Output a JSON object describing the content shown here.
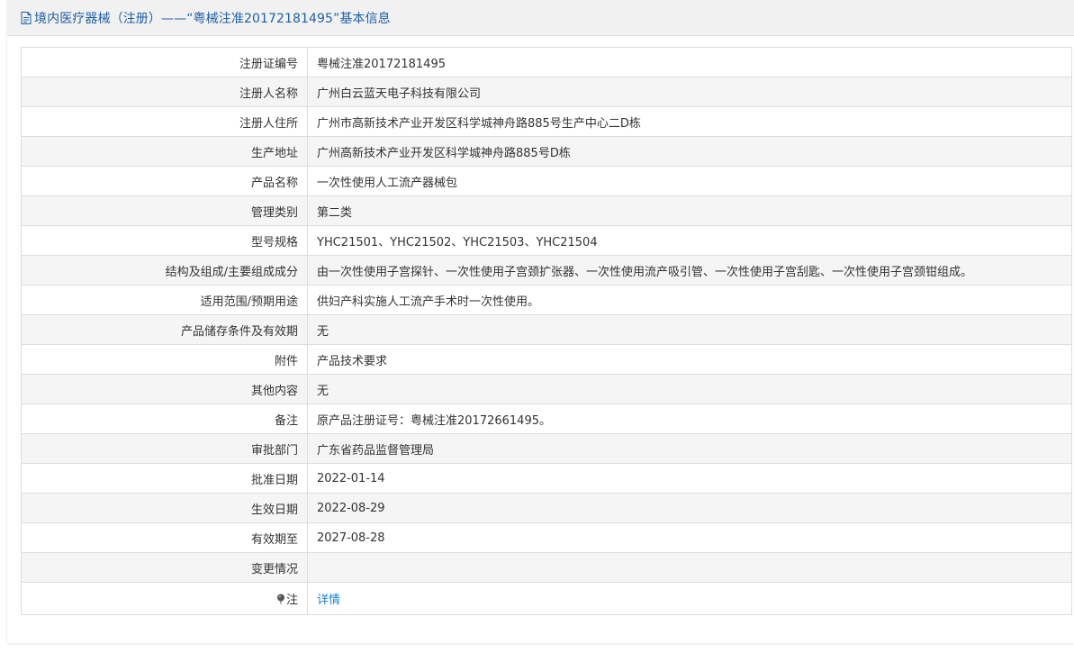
{
  "header": {
    "title": "境内医疗器械（注册）——“粤械注准20172181495”基本信息",
    "icon": "document-icon",
    "title_color": "#1f5fa8"
  },
  "rows": [
    {
      "label": "注册证编号",
      "value": "粤械注准20172181495"
    },
    {
      "label": "注册人名称",
      "value": "广州白云蓝天电子科技有限公司"
    },
    {
      "label": "注册人住所",
      "value": "广州市高新技术产业开发区科学城神舟路885号生产中心二D栋"
    },
    {
      "label": "生产地址",
      "value": "广州高新技术产业开发区科学城神舟路885号D栋"
    },
    {
      "label": "产品名称",
      "value": "一次性使用人工流产器械包"
    },
    {
      "label": "管理类别",
      "value": "第二类"
    },
    {
      "label": "型号规格",
      "value": "YHC21501、YHC21502、YHC21503、YHC21504"
    },
    {
      "label": "结构及组成/主要组成成分",
      "value": "由一次性使用子宫探针、一次性使用子宫颈扩张器、一次性使用流产吸引管、一次性使用子宫刮匙、一次性使用子宫颈钳组成。"
    },
    {
      "label": "适用范围/预期用途",
      "value": "供妇产科实施人工流产手术时一次性使用。"
    },
    {
      "label": "产品储存条件及有效期",
      "value": "无"
    },
    {
      "label": "附件",
      "value": "产品技术要求"
    },
    {
      "label": "其他内容",
      "value": "无"
    },
    {
      "label": "备注",
      "value": "原产品注册证号：粤械注准20172661495。"
    },
    {
      "label": "审批部门",
      "value": "广东省药品监督管理局"
    },
    {
      "label": "批准日期",
      "value": "2022-01-14"
    },
    {
      "label": "生效日期",
      "value": "2022-08-29"
    },
    {
      "label": "有效期至",
      "value": "2027-08-28"
    },
    {
      "label": "变更情况",
      "value": ""
    }
  ],
  "note_row": {
    "label": "注",
    "icon": "pin-icon",
    "link_text": "详情",
    "link_color": "#1a7fd6"
  }
}
